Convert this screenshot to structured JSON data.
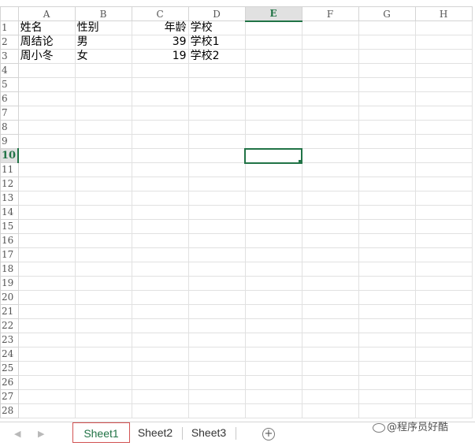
{
  "columns": [
    "A",
    "B",
    "C",
    "D",
    "E",
    "F",
    "G",
    "H"
  ],
  "selected_column": "E",
  "selected_row": 10,
  "rows": [
    {
      "num": "1",
      "cells": [
        "姓名",
        "性别",
        "年龄",
        "学校",
        "",
        "",
        "",
        ""
      ]
    },
    {
      "num": "2",
      "cells": [
        "周结论",
        "男",
        "39",
        "学校1",
        "",
        "",
        "",
        ""
      ]
    },
    {
      "num": "3",
      "cells": [
        "周小冬",
        "女",
        "19",
        "学校2",
        "",
        "",
        "",
        ""
      ]
    },
    {
      "num": "4",
      "cells": [
        "",
        "",
        "",
        "",
        "",
        "",
        "",
        ""
      ]
    },
    {
      "num": "5",
      "cells": [
        "",
        "",
        "",
        "",
        "",
        "",
        "",
        ""
      ]
    },
    {
      "num": "6",
      "cells": [
        "",
        "",
        "",
        "",
        "",
        "",
        "",
        ""
      ]
    },
    {
      "num": "7",
      "cells": [
        "",
        "",
        "",
        "",
        "",
        "",
        "",
        ""
      ]
    },
    {
      "num": "8",
      "cells": [
        "",
        "",
        "",
        "",
        "",
        "",
        "",
        ""
      ]
    },
    {
      "num": "9",
      "cells": [
        "",
        "",
        "",
        "",
        "",
        "",
        "",
        ""
      ]
    },
    {
      "num": "10",
      "cells": [
        "",
        "",
        "",
        "",
        "",
        "",
        "",
        ""
      ]
    },
    {
      "num": "11",
      "cells": [
        "",
        "",
        "",
        "",
        "",
        "",
        "",
        ""
      ]
    },
    {
      "num": "12",
      "cells": [
        "",
        "",
        "",
        "",
        "",
        "",
        "",
        ""
      ]
    },
    {
      "num": "13",
      "cells": [
        "",
        "",
        "",
        "",
        "",
        "",
        "",
        ""
      ]
    },
    {
      "num": "14",
      "cells": [
        "",
        "",
        "",
        "",
        "",
        "",
        "",
        ""
      ]
    },
    {
      "num": "15",
      "cells": [
        "",
        "",
        "",
        "",
        "",
        "",
        "",
        ""
      ]
    },
    {
      "num": "16",
      "cells": [
        "",
        "",
        "",
        "",
        "",
        "",
        "",
        ""
      ]
    },
    {
      "num": "17",
      "cells": [
        "",
        "",
        "",
        "",
        "",
        "",
        "",
        ""
      ]
    },
    {
      "num": "18",
      "cells": [
        "",
        "",
        "",
        "",
        "",
        "",
        "",
        ""
      ]
    },
    {
      "num": "19",
      "cells": [
        "",
        "",
        "",
        "",
        "",
        "",
        "",
        ""
      ]
    },
    {
      "num": "20",
      "cells": [
        "",
        "",
        "",
        "",
        "",
        "",
        "",
        ""
      ]
    },
    {
      "num": "21",
      "cells": [
        "",
        "",
        "",
        "",
        "",
        "",
        "",
        ""
      ]
    },
    {
      "num": "22",
      "cells": [
        "",
        "",
        "",
        "",
        "",
        "",
        "",
        ""
      ]
    },
    {
      "num": "23",
      "cells": [
        "",
        "",
        "",
        "",
        "",
        "",
        "",
        ""
      ]
    },
    {
      "num": "24",
      "cells": [
        "",
        "",
        "",
        "",
        "",
        "",
        "",
        ""
      ]
    },
    {
      "num": "25",
      "cells": [
        "",
        "",
        "",
        "",
        "",
        "",
        "",
        ""
      ]
    },
    {
      "num": "26",
      "cells": [
        "",
        "",
        "",
        "",
        "",
        "",
        "",
        ""
      ]
    },
    {
      "num": "27",
      "cells": [
        "",
        "",
        "",
        "",
        "",
        "",
        "",
        ""
      ]
    },
    {
      "num": "28",
      "cells": [
        "",
        "",
        "",
        "",
        "",
        "",
        "",
        ""
      ]
    }
  ],
  "numeric_columns": [
    "C"
  ],
  "sheet_tabs": [
    "Sheet1",
    "Sheet2",
    "Sheet3"
  ],
  "active_tab": "Sheet1",
  "add_sheet_symbol": "+",
  "nav_icons": [
    "scroll-left-icon",
    "scroll-right-icon"
  ],
  "watermark_text": "@程序员好酷",
  "colors": {
    "accent": "#217346",
    "active_tab_border": "#d25252",
    "gridline": "#e1e1e1"
  }
}
